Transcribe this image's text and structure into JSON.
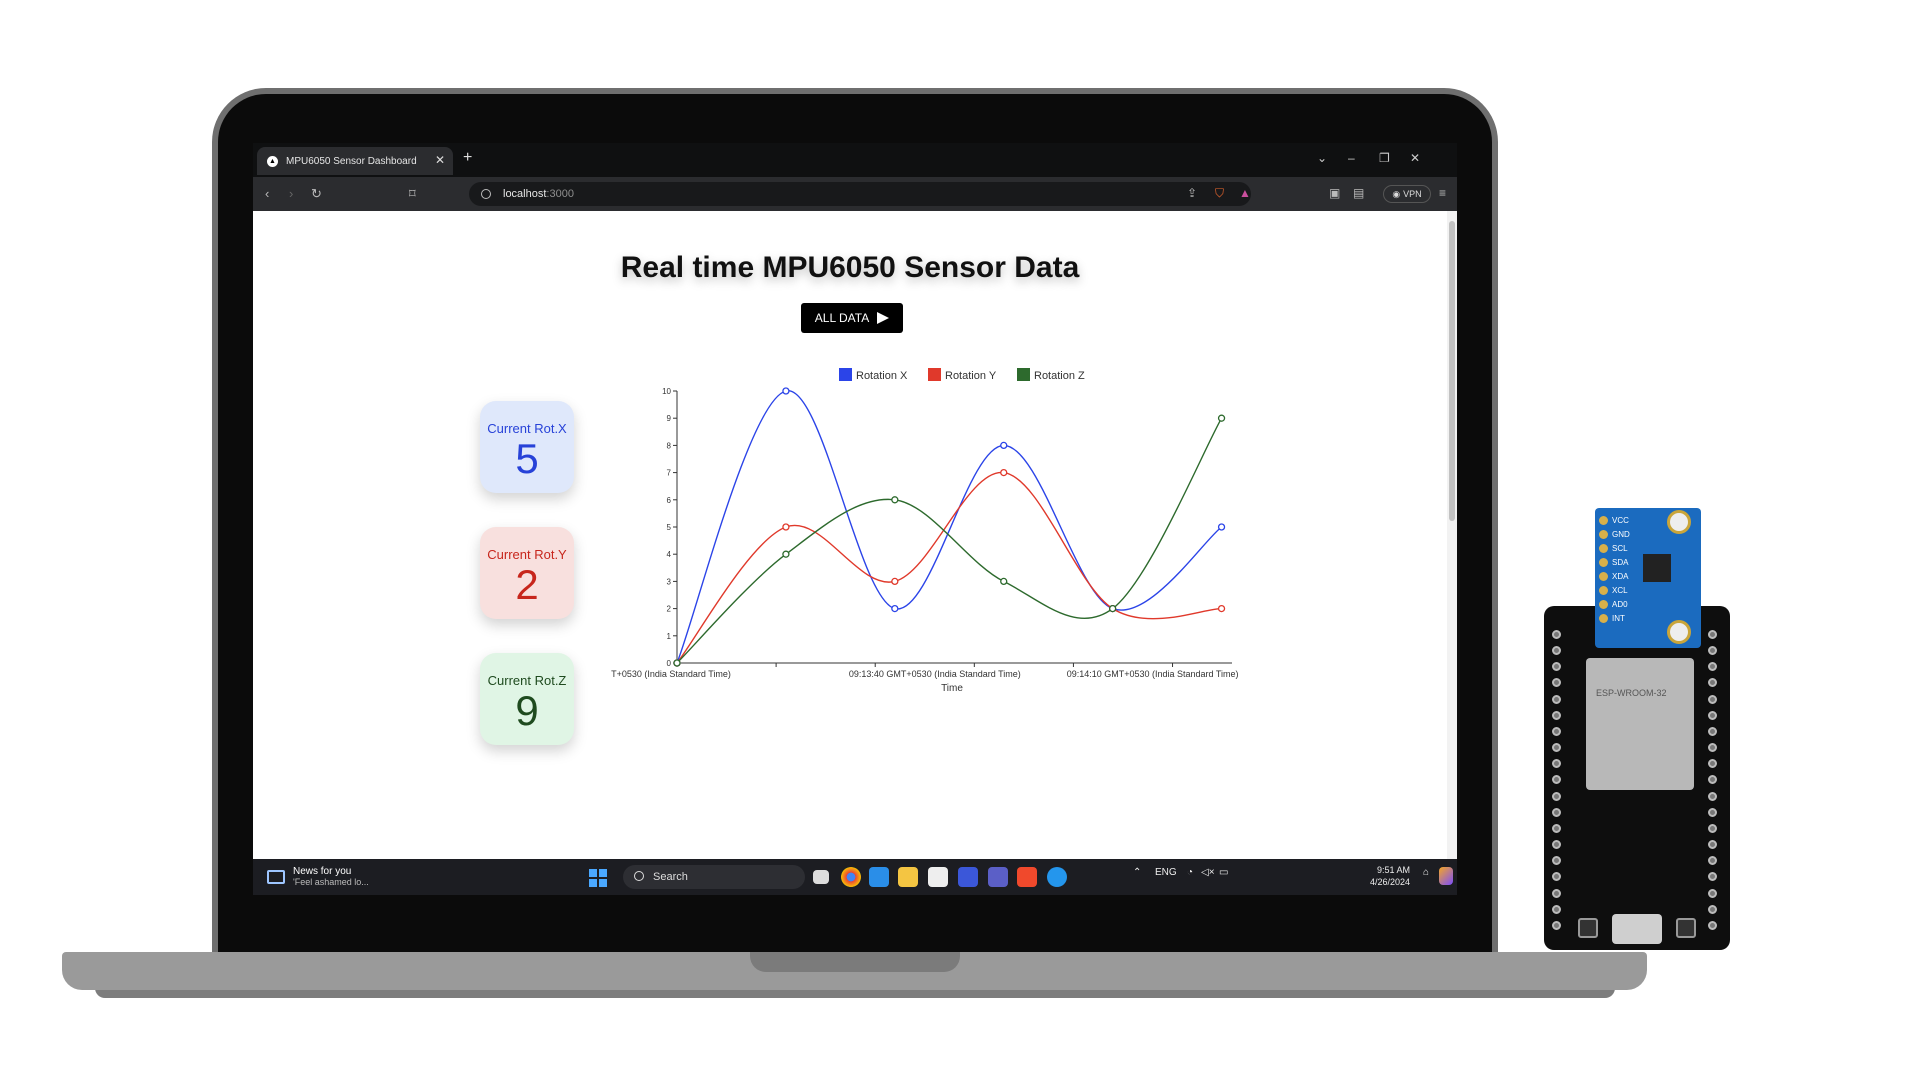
{
  "browser": {
    "tab_title": "MPU6050 Sensor Dashboard",
    "url_host": "localhost",
    "url_port": ":3000",
    "vpn_label": "VPN"
  },
  "page": {
    "title": "Real time MPU6050 Sensor Data",
    "all_data_button": "ALL DATA"
  },
  "cards": {
    "x": {
      "label": "Current Rot.X",
      "value": "5",
      "color": "#2742d8"
    },
    "y": {
      "label": "Current Rot.Y",
      "value": "2",
      "color": "#c7261c"
    },
    "z": {
      "label": "Current Rot.Z",
      "value": "9",
      "color": "#1f4b1f"
    }
  },
  "chart_data": {
    "type": "line",
    "xlabel": "Time",
    "ylabel": "",
    "ylim": [
      0,
      10
    ],
    "y_ticks": [
      0,
      1,
      2,
      3,
      4,
      5,
      6,
      7,
      8,
      9,
      10
    ],
    "x_tick_labels": [
      "T+0530 (India Standard Time)",
      "09:13:40 GMT+0530 (India Standard Time)",
      "09:14:10 GMT+0530 (India Standard Time)"
    ],
    "x_tick_at": [
      0,
      2,
      4
    ],
    "x": [
      0,
      1,
      2,
      3,
      4,
      5
    ],
    "legend_position": "top-center",
    "series": [
      {
        "name": "Rotation X",
        "color": "#2b44e8",
        "values": [
          0,
          10,
          2,
          8,
          2,
          5
        ]
      },
      {
        "name": "Rotation Y",
        "color": "#e0392b",
        "values": [
          0,
          5,
          3,
          7,
          2,
          2
        ]
      },
      {
        "name": "Rotation Z",
        "color": "#2d6a2d",
        "values": [
          0,
          4,
          6,
          3,
          2,
          9
        ]
      }
    ]
  },
  "taskbar": {
    "news_title": "News for you",
    "news_sub": "'Feel ashamed lo...",
    "search_label": "Search",
    "lang": "ENG",
    "time": "9:51 AM",
    "date": "4/26/2024"
  },
  "mpu_pins": [
    "VCC",
    "GND",
    "SCL",
    "SDA",
    "XDA",
    "XCL",
    "AD0",
    "INT"
  ],
  "module_label": "ESP-WROOM-32"
}
